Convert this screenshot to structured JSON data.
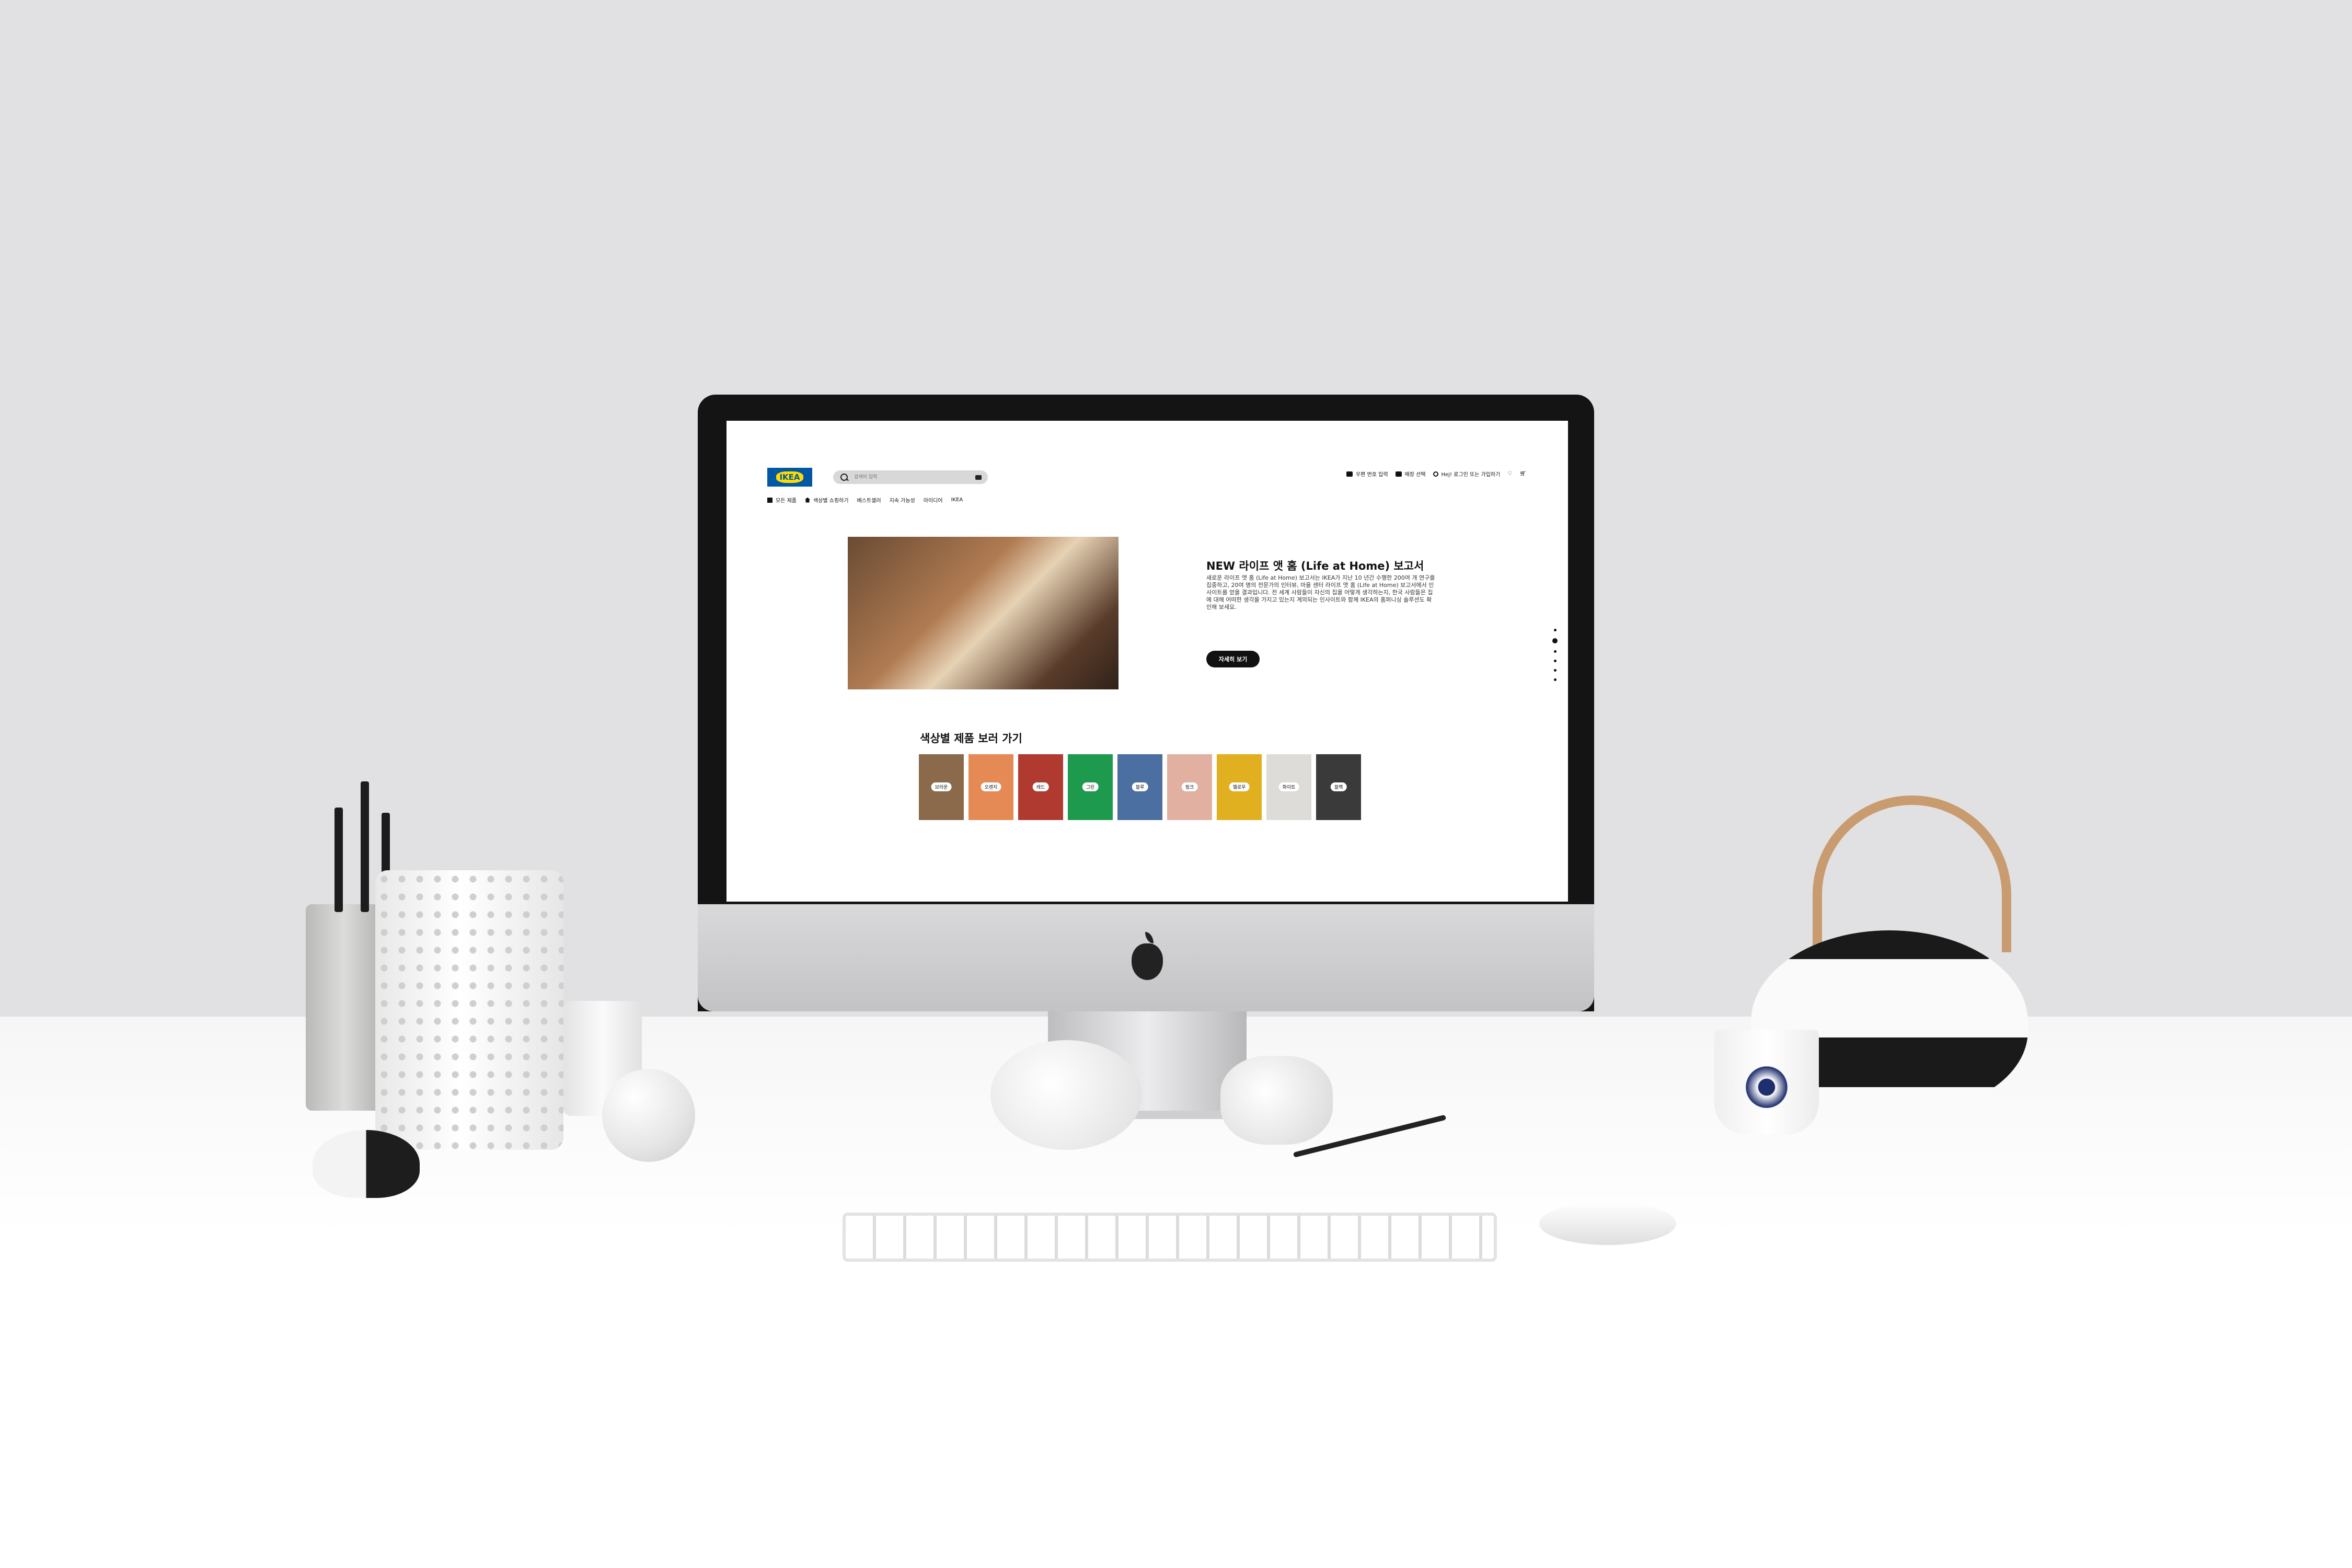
{
  "header": {
    "logo_text": "IKEA",
    "search": {
      "placeholder": "검색어 입력"
    },
    "utility_links": [
      "우편 번호 입력",
      "매장 선택",
      "Hej! 로그인 또는 가입하기"
    ]
  },
  "nav": {
    "items": [
      "모든 제품",
      "색상별 쇼핑하기",
      "베스트셀러",
      "지속 가능성",
      "아이디어",
      "IKEA"
    ]
  },
  "hero": {
    "title": "NEW 라이프 앳 홈 (Life at Home) 보고서",
    "description": "새로운 라이프 앳 홈 (Life at Home) 보고서는 IKEA가 지난 10 년간 수행한 200여 개 연구를 집중하고, 20여 명의 전문가의 인터뷰, 마을 센터 라이프 앳 홈 (Life at Home) 보고서에서 인사이트를 얻을 결과입니다. 전 세계 사람들이 자신의 집을 어떻게 생각하는지, 한국 사람들은 집에 대해 어떠한 생각을 가지고 있는지 계의되는 인사이트와 함께 IKEA의 홈퍼니싱 솔루션도 확인해 보세요.",
    "button_label": "자세히 보기",
    "slide_count": 6,
    "active_slide": 2
  },
  "colors_section": {
    "title": "색상별 제품 보러 가기",
    "swatches": [
      {
        "label": "브라운",
        "color": "#8a6a4a"
      },
      {
        "label": "오렌지",
        "color": "#e58a55"
      },
      {
        "label": "레드",
        "color": "#b03a30"
      },
      {
        "label": "그린",
        "color": "#1e9a4e"
      },
      {
        "label": "블루",
        "color": "#4a6fa0"
      },
      {
        "label": "핑크",
        "color": "#e2b0a0"
      },
      {
        "label": "옐로우",
        "color": "#e0b020"
      },
      {
        "label": "화이트",
        "color": "#dedcd8"
      },
      {
        "label": "블랙",
        "color": "#3a3a3a"
      }
    ]
  },
  "colors": {
    "ikea_blue": "#0058a3",
    "ikea_yellow": "#ffdb00"
  }
}
